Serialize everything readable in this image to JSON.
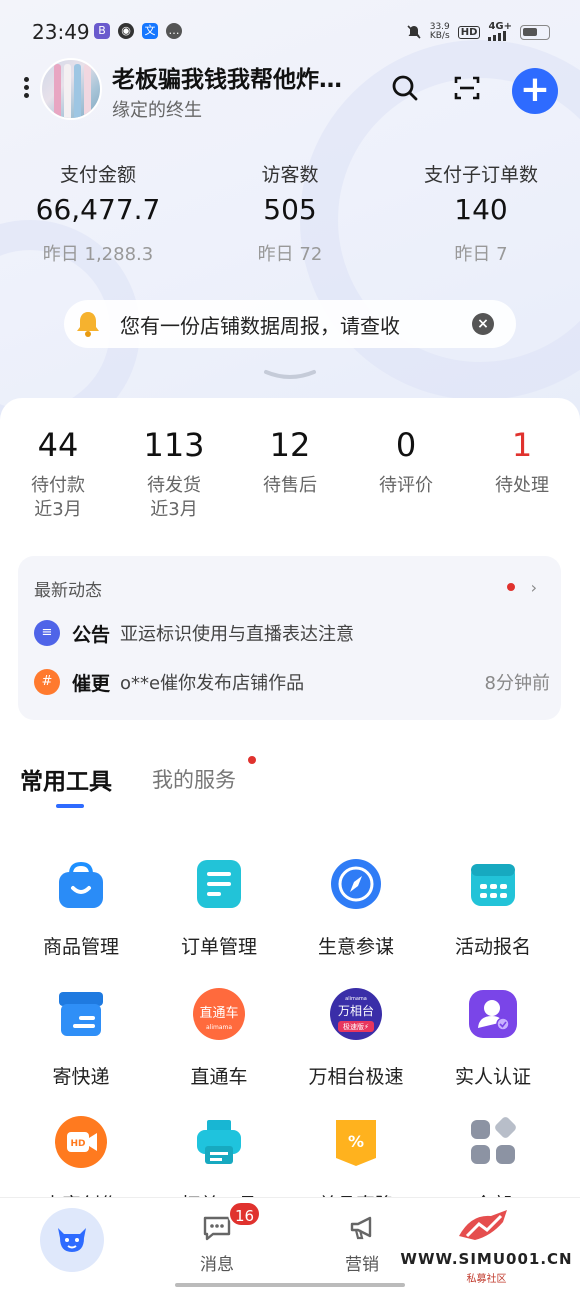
{
  "status_bar": {
    "time": "23:49",
    "net_speed_value": "33.9",
    "net_speed_unit": "KB/s",
    "hd": "HD",
    "signal": "4G+"
  },
  "header": {
    "shop_name": "老板骗我钱我帮他炸…",
    "shop_subtitle": "缘定的终生",
    "add_label": "+"
  },
  "stats": [
    {
      "label": "支付金额",
      "value": "66,477.7",
      "prev": "昨日 1,288.3"
    },
    {
      "label": "访客数",
      "value": "505",
      "prev": "昨日 72"
    },
    {
      "label": "支付子订单数",
      "value": "140",
      "prev": "昨日 7"
    }
  ],
  "notice": {
    "text": "您有一份店铺数据周报，请查收",
    "close": "×"
  },
  "todos": [
    {
      "num": "44",
      "label": "待付款",
      "sub": "近3月"
    },
    {
      "num": "113",
      "label": "待发货",
      "sub": "近3月"
    },
    {
      "num": "12",
      "label": "待售后",
      "sub": ""
    },
    {
      "num": "0",
      "label": "待评价",
      "sub": ""
    },
    {
      "num": "1",
      "label": "待处理",
      "sub": ""
    }
  ],
  "feed": {
    "title": "最新动态",
    "more": "›",
    "items": [
      {
        "kind": "公告",
        "text": "亚运标识使用与直播表达注意",
        "time": "",
        "badge": "≡"
      },
      {
        "kind": "催更",
        "text": "o**e催你发布店铺作品",
        "time": "8分钟前",
        "badge": "#"
      }
    ]
  },
  "tabs": {
    "active": "常用工具",
    "other": "我的服务"
  },
  "tools": [
    {
      "name": "商品管理",
      "icon": "shopping-bag-icon"
    },
    {
      "name": "订单管理",
      "icon": "order-list-icon"
    },
    {
      "name": "生意参谋",
      "icon": "compass-icon"
    },
    {
      "name": "活动报名",
      "icon": "calendar-grid-icon"
    },
    {
      "name": "寄快递",
      "icon": "parcel-box-icon"
    },
    {
      "name": "直通车",
      "icon": "ztc-logo-icon"
    },
    {
      "name": "万相台极速",
      "icon": "wxt-logo-icon"
    },
    {
      "name": "实人认证",
      "icon": "verified-person-icon"
    },
    {
      "name": "内容创作",
      "icon": "hd-video-icon"
    },
    {
      "name": "打单工具",
      "icon": "printer-icon"
    },
    {
      "name": "单品直降",
      "icon": "discount-coupon-icon"
    },
    {
      "name": "全部",
      "icon": "all-apps-icon"
    }
  ],
  "tool_logo_text": {
    "ztc": "直通车",
    "ztc_sub": "alimama",
    "wxt": "万相台",
    "wxt_top": "alimama",
    "wxt_sub": "极速版⚡",
    "hd": "HD"
  },
  "bottom_nav": {
    "messages_label": "消息",
    "messages_badge": "16",
    "marketing_label": "营销"
  },
  "watermark": {
    "site": "WWW.SIMU001.CN",
    "cn": "私募社区"
  },
  "colors": {
    "accent": "#2e6bff",
    "alert_red": "#e0322e"
  }
}
